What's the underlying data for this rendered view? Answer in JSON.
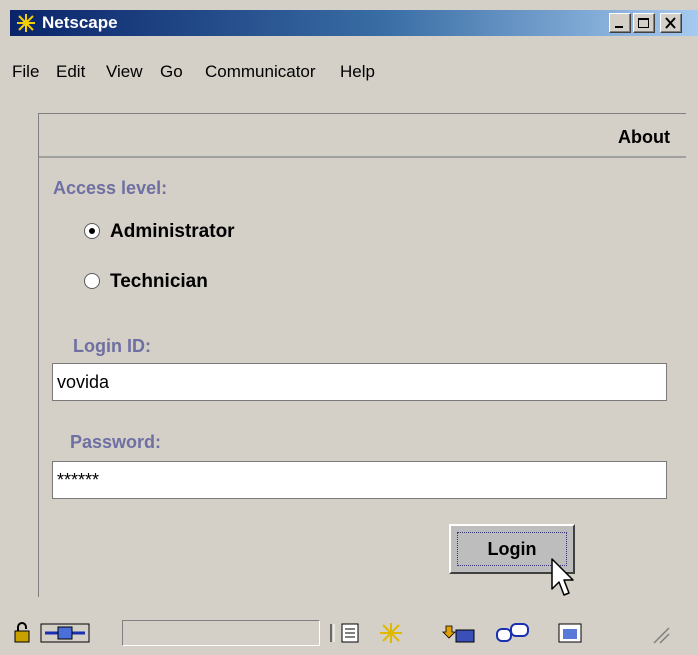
{
  "window": {
    "title": "Netscape"
  },
  "menu": {
    "items": [
      "File",
      "Edit",
      "View",
      "Go",
      "Communicator",
      "Help"
    ]
  },
  "header": {
    "about_label": "About"
  },
  "form": {
    "access_level_label": "Access level:",
    "options": [
      {
        "label": "Administrator",
        "selected": true
      },
      {
        "label": "Technician",
        "selected": false
      }
    ],
    "login_id_label": "Login ID:",
    "login_id_value": "vovida",
    "password_label": "Password:",
    "password_value": "******",
    "login_button_label": "Login"
  },
  "colors": {
    "label_color": "#6e6fa2",
    "titlebar_start": "#0a246a",
    "panel_bg": "#d4d0c8"
  }
}
